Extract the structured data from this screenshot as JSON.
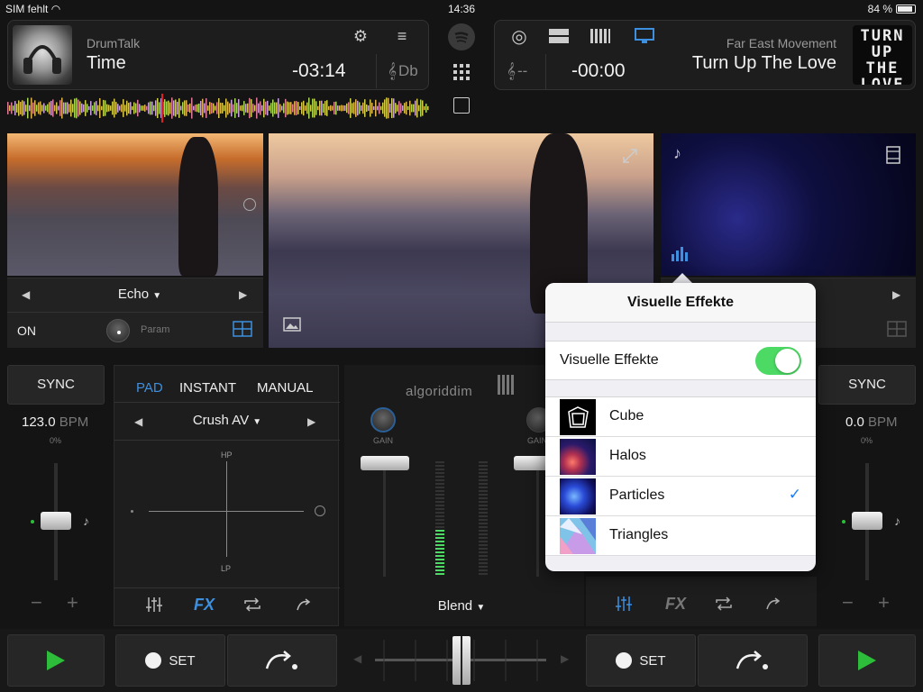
{
  "status": {
    "carrier": "SIM fehlt",
    "time": "14:36",
    "battery": "84 %"
  },
  "deck_left": {
    "artist": "DrumTalk",
    "title": "Time",
    "time": "-03:14",
    "key": "Db",
    "fx_name": "Echo",
    "on_label": "ON",
    "param_label": "Param",
    "sync_label": "SYNC",
    "bpm": "123.0",
    "bpm_unit": "BPM",
    "pitch": "0%"
  },
  "deck_right": {
    "artist": "Far East Movement",
    "title": "Turn Up The Love",
    "time": "-00:00",
    "key": "--",
    "cover_text": [
      "TURN",
      "UP",
      "THE",
      "LOVE"
    ],
    "sync_label": "SYNC",
    "bpm": "0.0",
    "bpm_unit": "BPM",
    "pitch": "0%"
  },
  "pad": {
    "tabs": [
      "PAD",
      "INSTANT",
      "MANUAL"
    ],
    "active_tab": "PAD",
    "effect": "Crush AV",
    "hp_label": "HP",
    "lp_label": "LP",
    "fx_label": "FX"
  },
  "mixer": {
    "logo": "algoriddim",
    "gain_label": "GAIN",
    "blend_label": "Blend"
  },
  "transport": {
    "set_label": "SET"
  },
  "popover": {
    "title": "Visuelle Effekte",
    "toggle_label": "Visuelle Effekte",
    "toggle_on": true,
    "items": [
      {
        "label": "Cube",
        "selected": false
      },
      {
        "label": "Halos",
        "selected": false
      },
      {
        "label": "Particles",
        "selected": true
      },
      {
        "label": "Triangles",
        "selected": false
      }
    ]
  },
  "colors": {
    "accent": "#3d8fe0",
    "play": "#2ebd3a",
    "switch_on": "#4cd964"
  }
}
